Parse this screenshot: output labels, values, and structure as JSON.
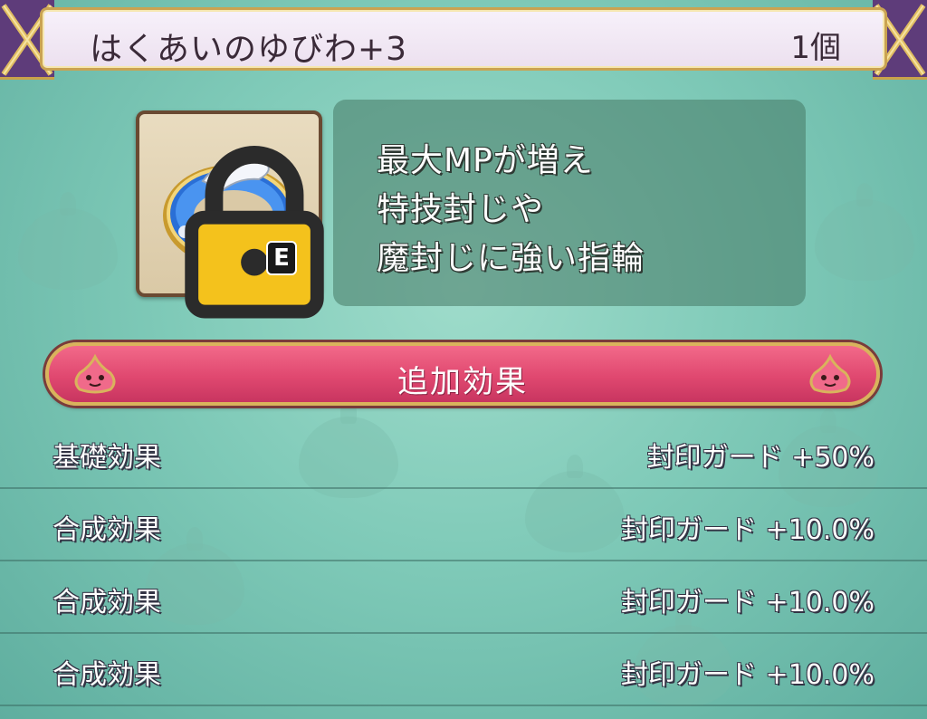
{
  "item": {
    "name": "はくあいのゆびわ+3",
    "count": "1個",
    "equip_badge": "E",
    "locked": true,
    "icon": "ring-icon"
  },
  "description": {
    "lines": [
      "最大MPが増え",
      "特技封じや",
      "魔封じに強い指輪"
    ]
  },
  "section": {
    "title": "追加効果"
  },
  "effects": [
    {
      "label": "基礎効果",
      "value": "封印ガード +50%"
    },
    {
      "label": "合成効果",
      "value": "封印ガード +10.0%"
    },
    {
      "label": "合成効果",
      "value": "封印ガード +10.0%"
    },
    {
      "label": "合成効果",
      "value": "封印ガード +10.0%"
    }
  ],
  "colors": {
    "background": "#7fcab8",
    "banner": "#e04870",
    "frame_gold": "#caa352",
    "corner_purple": "#5e3c7a"
  }
}
